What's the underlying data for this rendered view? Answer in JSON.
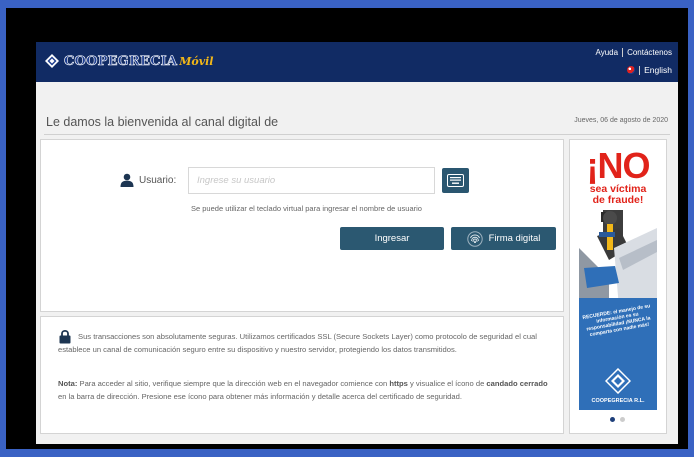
{
  "header": {
    "brand": "COOPEGRECIA",
    "brand_sub": "Móvil",
    "links": {
      "help": "Ayuda",
      "contact": "Contáctenos"
    },
    "language": "English"
  },
  "page": {
    "welcome": "Le damos la bienvenida al canal digital de",
    "date": "Jueves, 06 de agosto de 2020"
  },
  "login": {
    "user_label": "Usuario:",
    "user_placeholder": "Ingrese su usuario",
    "user_value": "",
    "hint": "Se puede utilizar el teclado virtual para ingresar el nombre de usuario",
    "submit_label": "Ingresar",
    "digital_signature_label": "Firma digital"
  },
  "security": {
    "p1": "Sus transacciones son absolutamente seguras. Utilizamos certificados SSL (Secure Sockets Layer) como protocolo de seguridad el cual establece un canal de comunicación seguro entre su dispositivo y nuestro servidor, protegiendo los datos transmitidos.",
    "note_label": "Nota:",
    "p2_a": " Para acceder al sitio, verifique siempre que la dirección web en el navegador comience con ",
    "https": "https",
    "p2_b": " y visualice el ícono de ",
    "lock_text": "candado cerrado",
    "p2_c": " en la barra de dirección. Presione ese ícono para obtener más información y detalle acerca del certificado de seguridad."
  },
  "banner": {
    "headline": "¡NO",
    "subline_1": "sea víctima",
    "subline_2": "de fraude!",
    "reminder": "RECUERDE: el manejo de su información es su responsabilidad ¡NUNCA la comparta con nadie más!",
    "brand": "COOPEGRECIA R.L.",
    "slides": 2,
    "active_slide": 1
  },
  "colors": {
    "header_bg": "#112b64",
    "button_bg": "#2b5871",
    "page_border": "#3a62c4",
    "alert_red": "#e1231a"
  },
  "icons": [
    "diamond-logo-icon",
    "flag-icon",
    "user-icon",
    "keyboard-icon",
    "fingerprint-icon",
    "lock-icon",
    "shield-emblem-icon"
  ]
}
